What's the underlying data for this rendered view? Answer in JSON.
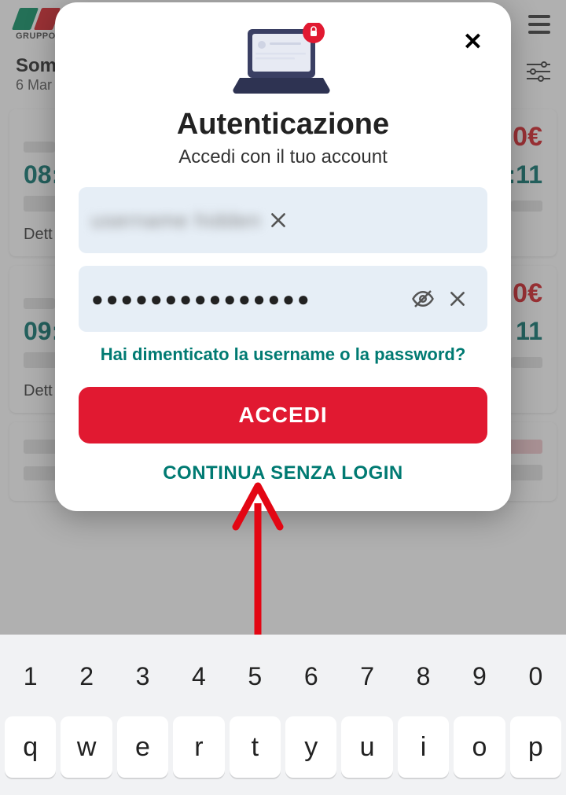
{
  "header": {
    "logo_text": "GRUPPO",
    "route": "Somm",
    "date": "6 Mar"
  },
  "cards": [
    {
      "price": "0€",
      "time_dep": "08:",
      "time_arr": ":11",
      "details": "Dett"
    },
    {
      "price": "0€",
      "time_dep": "09:",
      "time_arr": "11",
      "details": "Dett"
    }
  ],
  "modal": {
    "title": "Autenticazione",
    "subtitle": "Accedi con il tuo account",
    "username_placeholder": "Username",
    "password_mask": "●●●●●●●●●●●●●●●",
    "forgot": "Hai dimenticato la username o la password?",
    "login": "ACCEDI",
    "continue": "CONTINUA SENZA LOGIN"
  },
  "keyboard": {
    "row1": [
      "1",
      "2",
      "3",
      "4",
      "5",
      "6",
      "7",
      "8",
      "9",
      "0"
    ],
    "row2": [
      "q",
      "w",
      "e",
      "r",
      "t",
      "y",
      "u",
      "i",
      "o",
      "p"
    ]
  },
  "colors": {
    "accent": "#e11931",
    "teal": "#007a72"
  }
}
